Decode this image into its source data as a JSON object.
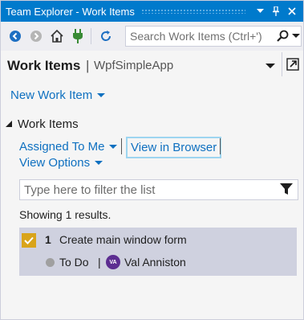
{
  "window": {
    "title": "Team Explorer - Work Items"
  },
  "toolbar": {
    "buttons": [
      "back-icon",
      "forward-icon",
      "home-icon",
      "connect-icon",
      "refresh-icon"
    ],
    "search_placeholder": "Search Work Items (Ctrl+')"
  },
  "header": {
    "title": "Work Items",
    "separator": "|",
    "project": "WpfSimpleApp"
  },
  "actions": {
    "new_work_item": "New Work Item"
  },
  "section": {
    "title": "Work Items",
    "assigned_to_me": "Assigned To Me",
    "view_in_browser": "View in Browser",
    "view_options": "View Options",
    "filter_placeholder": "Type here to filter the list",
    "results_text": "Showing 1 results."
  },
  "work_items": [
    {
      "id": "1",
      "title": "Create main window form",
      "state": "To Do",
      "separator": "|",
      "assignee_initials": "VA",
      "assignee": "Val Anniston"
    }
  ],
  "colors": {
    "accent": "#007acc",
    "link": "#0e70c0",
    "row_selected": "#cfd1df",
    "task_icon": "#d9a41a",
    "avatar": "#5c2d91"
  }
}
